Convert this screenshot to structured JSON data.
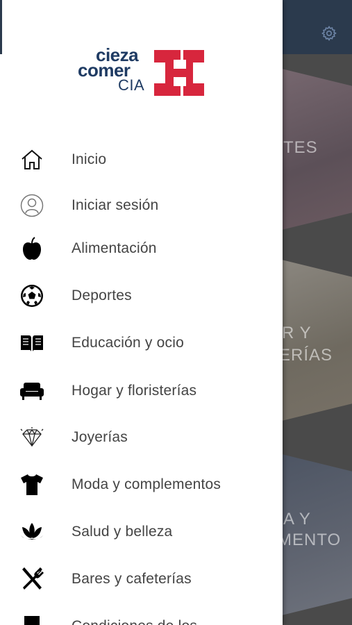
{
  "app": {
    "brand_line1": "cieza",
    "brand_line2": "comer",
    "brand_line3": "CIA"
  },
  "colors": {
    "brand_navy": "#1f3b63",
    "brand_red": "#d7263d",
    "header_bg": "#2b3a4d"
  },
  "background": {
    "tiles": [
      {
        "label": "TES"
      },
      {
        "label_line1": "R Y",
        "label_line2": "ERÍAS"
      },
      {
        "label_line1": "A Y",
        "label_line2": "MENTO"
      }
    ]
  },
  "menu": {
    "items": [
      {
        "label": "Inicio",
        "icon": "home-icon"
      },
      {
        "label": "Iniciar sesión",
        "icon": "user-icon"
      },
      {
        "label": "Alimentación",
        "icon": "apple-icon"
      },
      {
        "label": "Deportes",
        "icon": "soccer-ball-icon"
      },
      {
        "label": "Educación y ocio",
        "icon": "book-icon"
      },
      {
        "label": "Hogar y floristerías",
        "icon": "sofa-icon"
      },
      {
        "label": "Joyerías",
        "icon": "diamond-icon"
      },
      {
        "label": "Moda y complementos",
        "icon": "tshirt-icon"
      },
      {
        "label": "Salud y belleza",
        "icon": "lotus-icon"
      },
      {
        "label": "Bares y cafeterías",
        "icon": "fork-knife-icon"
      },
      {
        "label": "Condiciones de los",
        "icon": "document-icon"
      }
    ]
  }
}
